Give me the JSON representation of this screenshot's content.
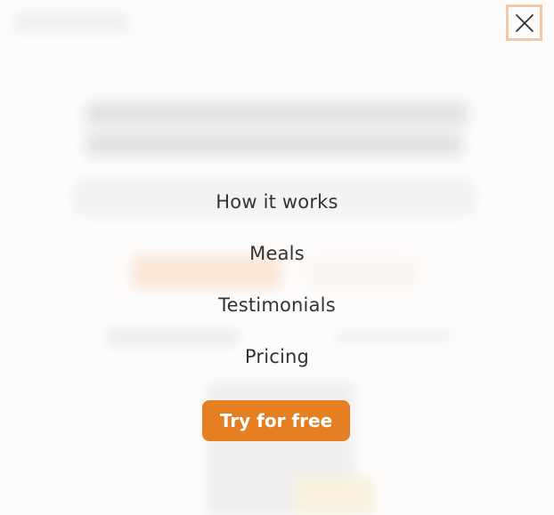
{
  "nav": {
    "items": [
      {
        "label": "How it works"
      },
      {
        "label": "Meals"
      },
      {
        "label": "Testimonials"
      },
      {
        "label": "Pricing"
      }
    ],
    "cta_label": "Try for free"
  },
  "close_icon": "close-icon",
  "colors": {
    "accent": "#e67e22",
    "close_border": "#f1c9a6",
    "text": "#333333",
    "background": "#fdfcfb"
  }
}
